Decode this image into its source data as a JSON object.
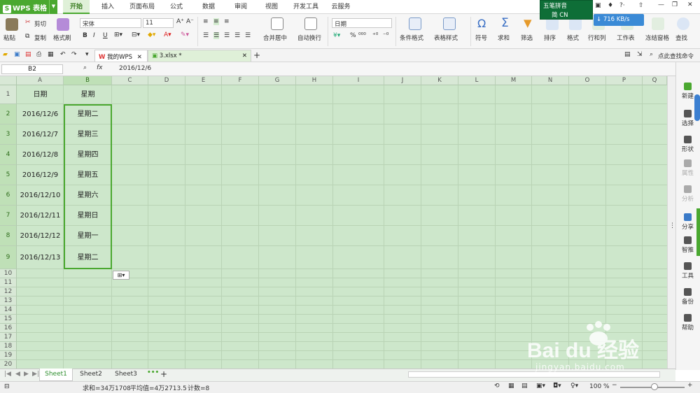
{
  "app": {
    "name": "WPS 表格"
  },
  "menu_tabs": [
    "开始",
    "插入",
    "页面布局",
    "公式",
    "数据",
    "审阅",
    "视图",
    "开发工具",
    "云服务"
  ],
  "ribbon": {
    "paste": "粘贴",
    "cut": "剪切",
    "copy": "复制",
    "format_painter": "格式刷",
    "font_name": "宋体",
    "font_size": "11",
    "bold": "B",
    "italic": "I",
    "underline": "U",
    "merge_center": "合并居中",
    "wrap_text": "自动换行",
    "number_format": "日期",
    "percent": "%",
    "comma": "⁰⁰⁰",
    "cond_format": "条件格式",
    "table_style": "表格样式",
    "symbol": "符号",
    "sum": "求和",
    "filter": "筛选",
    "sort": "排序",
    "format": "格式",
    "row_col": "行和列",
    "worksheet": "工作表",
    "freeze": "冻结窗格",
    "find": "查找"
  },
  "doc_tabs": [
    {
      "label": "我的WPS"
    },
    {
      "label": "3.xlsx *"
    }
  ],
  "search_cmd": "点此查找命令",
  "formula_bar": {
    "name_box": "B2",
    "fx": "fx",
    "content": "2016/12/6"
  },
  "columns": [
    "A",
    "B",
    "C",
    "D",
    "E",
    "F",
    "G",
    "H",
    "I",
    "J",
    "K",
    "L",
    "M",
    "N",
    "O",
    "P",
    "Q"
  ],
  "rows": [
    "1",
    "2",
    "3",
    "4",
    "5",
    "6",
    "7",
    "8",
    "9",
    "10",
    "11",
    "12",
    "13",
    "14",
    "15",
    "16",
    "17",
    "18",
    "19",
    "20"
  ],
  "table": {
    "header": [
      "日期",
      "星期"
    ],
    "data": [
      [
        "2016/12/6",
        "星期二"
      ],
      [
        "2016/12/7",
        "星期三"
      ],
      [
        "2016/12/8",
        "星期四"
      ],
      [
        "2016/12/9",
        "星期五"
      ],
      [
        "2016/12/10",
        "星期六"
      ],
      [
        "2016/12/11",
        "星期日"
      ],
      [
        "2016/12/12",
        "星期一"
      ],
      [
        "2016/12/13",
        "星期二"
      ]
    ]
  },
  "right_panel": [
    "新建",
    "选择",
    "形状",
    "属性",
    "分析",
    "分享",
    "智推",
    "工具",
    "备份",
    "帮助"
  ],
  "sheets": [
    "Sheet1",
    "Sheet2",
    "Sheet3"
  ],
  "status": {
    "sum": "求和=34万1708",
    "avg": "平均值=4万2713.5",
    "count": "计数=8",
    "zoom": "100 %"
  },
  "ime": {
    "title": "五笔拼音",
    "mode": "简 CN"
  },
  "network": {
    "speed": "716 KB/s"
  },
  "watermark": {
    "brand": "Bai du 经验",
    "url": "jingyan.baidu.com"
  },
  "colors": {
    "accent": "#4aa830",
    "grid_bg": "#cde7cb",
    "selection": "#4aa830"
  }
}
